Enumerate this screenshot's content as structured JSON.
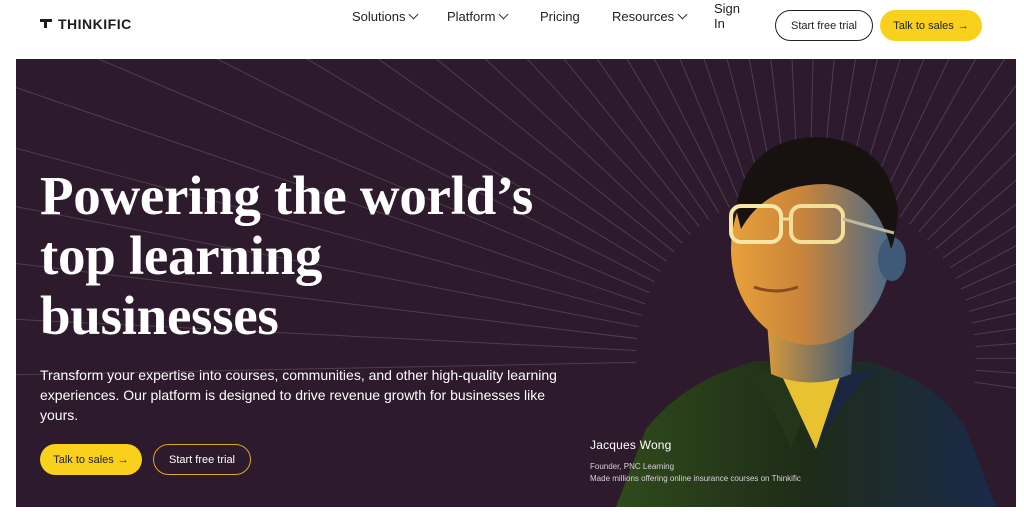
{
  "brand": {
    "name": "THINKIFIC"
  },
  "nav": {
    "items": [
      {
        "label": "Solutions"
      },
      {
        "label": "Platform"
      },
      {
        "label": "Pricing"
      },
      {
        "label": "Resources"
      },
      {
        "label": "Sign In"
      }
    ],
    "start_trial_label": "Start free trial",
    "talk_sales_label": "Talk to sales",
    "arrow": "→"
  },
  "hero": {
    "title_line1": "Powering the world’s",
    "title_line2": "top learning",
    "title_line3": "businesses",
    "subtitle": "Transform your expertise into courses, communities, and other high-quality learning experiences. Our platform is designed to drive revenue growth for businesses like yours.",
    "cta_primary": "Talk to sales",
    "cta_secondary": "Start free trial",
    "arrow": "→",
    "testimonial": {
      "name": "Jacques Wong",
      "role": "Founder, PNC Learning",
      "desc": "Made millions offering online insurance courses on Thinkific"
    }
  },
  "colors": {
    "hero_bg": "#2d1a2c",
    "accent_yellow": "#f9d01b",
    "nav_bg": "#ffffff"
  },
  "icons": [
    "logo-mark-icon",
    "chevron-down-icon",
    "arrow-right-icon"
  ]
}
